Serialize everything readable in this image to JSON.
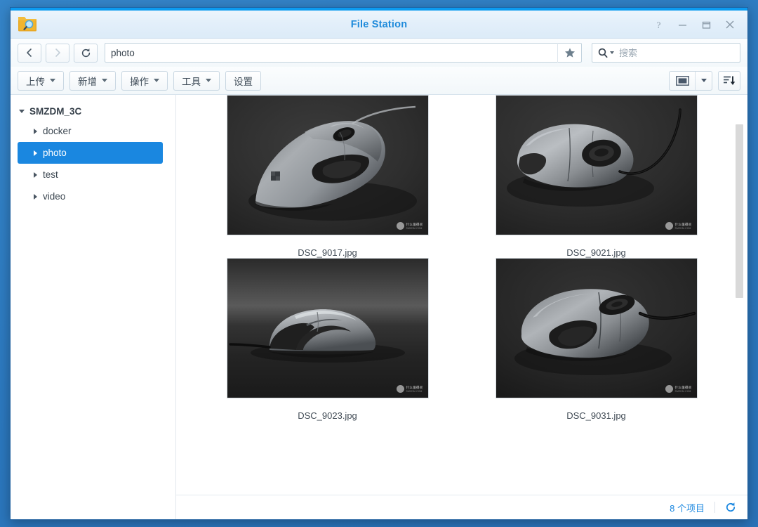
{
  "window": {
    "title": "File Station",
    "icon": "folder-search-icon",
    "controls": [
      {
        "name": "help-button",
        "glyph": "?"
      },
      {
        "name": "minimize-button",
        "glyph": "–"
      },
      {
        "name": "maximize-button",
        "glyph": "☐"
      },
      {
        "name": "close-button",
        "glyph": "✕"
      }
    ]
  },
  "navbar": {
    "back_label": "‹",
    "forward_label": "›",
    "refresh_label": "↻",
    "path_value": "photo",
    "path_placeholder": "",
    "favorite_icon": "star-icon",
    "search_placeholder": "搜索",
    "search_value": ""
  },
  "toolbar": {
    "buttons": [
      {
        "label": "上传",
        "caret": true,
        "name": "upload-button"
      },
      {
        "label": "新增",
        "caret": true,
        "name": "create-button"
      },
      {
        "label": "操作",
        "caret": true,
        "name": "action-button"
      },
      {
        "label": "工具",
        "caret": true,
        "name": "tools-button"
      },
      {
        "label": "设置",
        "caret": false,
        "name": "settings-button"
      }
    ],
    "view_mode_icon": "thumbnail-view-icon",
    "view_mode_caret": "chevron-down-icon",
    "sort_icon": "sort-descending-icon"
  },
  "sidebar": {
    "root": {
      "label": "SMZDM_3C",
      "expanded": true
    },
    "items": [
      {
        "label": "docker",
        "selected": false
      },
      {
        "label": "photo",
        "selected": true
      },
      {
        "label": "test",
        "selected": false
      },
      {
        "label": "video",
        "selected": false
      }
    ]
  },
  "files": [
    {
      "name": "DSC_9017.jpg",
      "view": "front-angle"
    },
    {
      "name": "DSC_9021.jpg",
      "view": "top-angle"
    },
    {
      "name": "DSC_9023.jpg",
      "view": "side-profile"
    },
    {
      "name": "DSC_9031.jpg",
      "view": "rear-angle"
    }
  ],
  "watermark": {
    "brand": "什么值得买",
    "url": "SMZDM.COM"
  },
  "statusbar": {
    "count_label": "8 个项目",
    "refresh_icon": "refresh-icon"
  },
  "colors": {
    "accent": "#0c9bf0",
    "selection": "#1a87e0",
    "title": "#1f8bdb",
    "desktop": "#2d7cc0"
  }
}
